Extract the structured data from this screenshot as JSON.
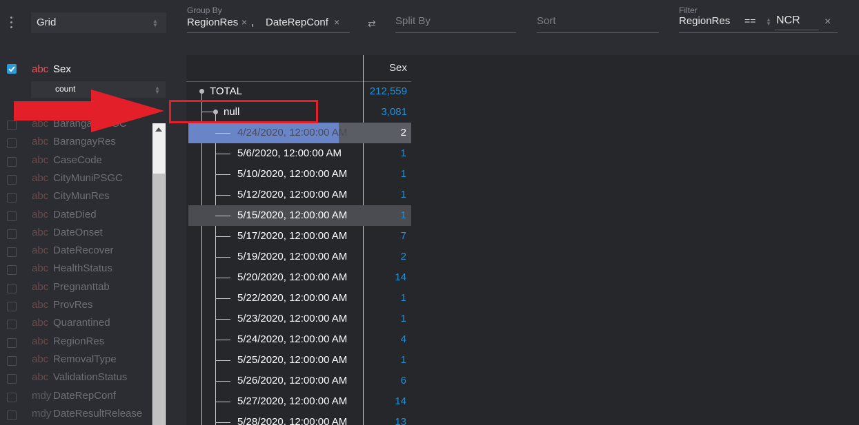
{
  "toolbar": {
    "view_select": "Grid",
    "group_by_caption": "Group By",
    "group_by_items": [
      "RegionRes",
      "DateRepConf"
    ],
    "group_sep": ",",
    "swap_icon": "⇄",
    "split_by_placeholder": "Split By",
    "sort_placeholder": "Sort",
    "filter_caption": "Filter",
    "filter_column": "RegionRes",
    "filter_op": "==",
    "filter_value": "NCR",
    "close_glyph": "×"
  },
  "columns_panel": {
    "active_column": {
      "type": "abc",
      "name": "Sex",
      "checked": true
    },
    "aggregate": "count",
    "inactive_columns": [
      {
        "type": "abc",
        "name": "BarangayPSGC"
      },
      {
        "type": "abc",
        "name": "BarangayRes"
      },
      {
        "type": "abc",
        "name": "CaseCode"
      },
      {
        "type": "abc",
        "name": "CityMuniPSGC"
      },
      {
        "type": "abc",
        "name": "CityMunRes"
      },
      {
        "type": "abc",
        "name": "DateDied"
      },
      {
        "type": "abc",
        "name": "DateOnset"
      },
      {
        "type": "abc",
        "name": "DateRecover"
      },
      {
        "type": "abc",
        "name": "HealthStatus"
      },
      {
        "type": "abc",
        "name": "Pregnanttab"
      },
      {
        "type": "abc",
        "name": "ProvRes"
      },
      {
        "type": "abc",
        "name": "Quarantined"
      },
      {
        "type": "abc",
        "name": "RegionRes"
      },
      {
        "type": "abc",
        "name": "RemovalType"
      },
      {
        "type": "abc",
        "name": "ValidationStatus"
      },
      {
        "type": "mdy",
        "name": "DateRepConf"
      },
      {
        "type": "mdy",
        "name": "DateResultRelease"
      }
    ]
  },
  "grid": {
    "column_header": "Sex",
    "total_label": "TOTAL",
    "total_value": "212,559",
    "null_label": "null",
    "null_value": "3,081",
    "rows": [
      {
        "label": "4/24/2020, 12:00:00 AM",
        "value": "2"
      },
      {
        "label": "5/6/2020, 12:00:00 AM",
        "value": "1"
      },
      {
        "label": "5/10/2020, 12:00:00 AM",
        "value": "1"
      },
      {
        "label": "5/12/2020, 12:00:00 AM",
        "value": "1"
      },
      {
        "label": "5/15/2020, 12:00:00 AM",
        "value": "1"
      },
      {
        "label": "5/17/2020, 12:00:00 AM",
        "value": "7"
      },
      {
        "label": "5/19/2020, 12:00:00 AM",
        "value": "2"
      },
      {
        "label": "5/20/2020, 12:00:00 AM",
        "value": "14"
      },
      {
        "label": "5/22/2020, 12:00:00 AM",
        "value": "1"
      },
      {
        "label": "5/23/2020, 12:00:00 AM",
        "value": "1"
      },
      {
        "label": "5/24/2020, 12:00:00 AM",
        "value": "4"
      },
      {
        "label": "5/25/2020, 12:00:00 AM",
        "value": "1"
      },
      {
        "label": "5/26/2020, 12:00:00 AM",
        "value": "6"
      },
      {
        "label": "5/27/2020, 12:00:00 AM",
        "value": "14"
      },
      {
        "label": "5/28/2020, 12:00:00 AM",
        "value": "13"
      }
    ]
  },
  "colors": {
    "background": "#2b2d33",
    "value_blue": "#1e90d8",
    "annotation_red": "#e3202a",
    "selected_row": "#6a84c8"
  }
}
